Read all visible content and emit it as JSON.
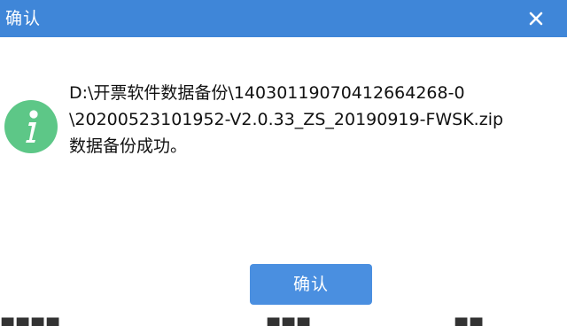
{
  "dialog": {
    "title": "确认",
    "close_icon": "close-icon",
    "info_icon": "info-icon",
    "message": {
      "line1": "D:\\开票软件数据备份\\140301190704126642​68-0",
      "line2": "\\20200523101952-V2.0.33_ZS_20190919-FWSK.zip",
      "line3": "数据备份成功。"
    },
    "confirm_label": "确认"
  },
  "colors": {
    "title_bar": "#3f86d8",
    "button": "#4a8fe0",
    "info_icon": "#5dc787"
  }
}
